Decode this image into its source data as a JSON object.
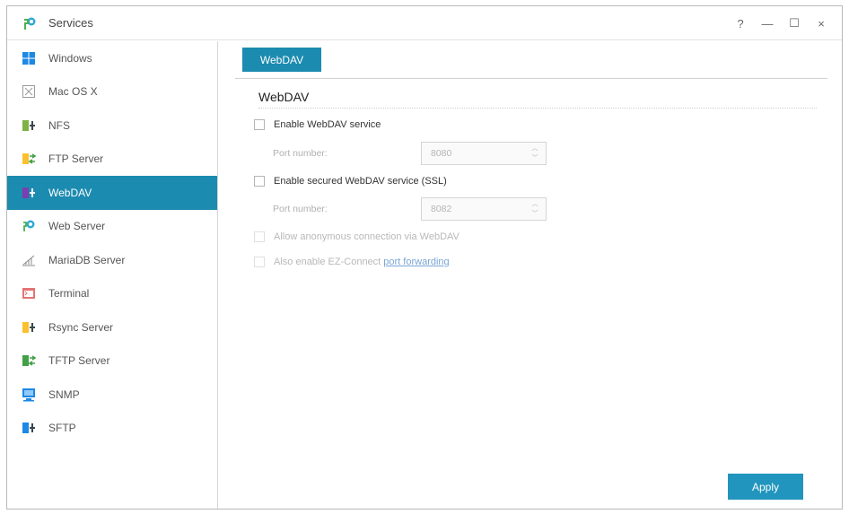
{
  "window": {
    "title": "Services",
    "controls": {
      "help": "?",
      "minimize": "—",
      "maximize": "☐",
      "close": "×"
    }
  },
  "sidebar": {
    "items": [
      {
        "label": "Windows",
        "icon": "windows-icon"
      },
      {
        "label": "Mac OS X",
        "icon": "macos-icon"
      },
      {
        "label": "NFS",
        "icon": "nfs-icon"
      },
      {
        "label": "FTP Server",
        "icon": "ftp-icon"
      },
      {
        "label": "WebDAV",
        "icon": "webdav-icon",
        "active": true
      },
      {
        "label": "Web Server",
        "icon": "web-server-icon"
      },
      {
        "label": "MariaDB Server",
        "icon": "mariadb-icon"
      },
      {
        "label": "Terminal",
        "icon": "terminal-icon"
      },
      {
        "label": "Rsync Server",
        "icon": "rsync-icon"
      },
      {
        "label": "TFTP Server",
        "icon": "tftp-icon"
      },
      {
        "label": "SNMP",
        "icon": "snmp-icon"
      },
      {
        "label": "SFTP",
        "icon": "sftp-icon"
      }
    ]
  },
  "main": {
    "tab": "WebDAV",
    "section_title": "WebDAV",
    "enable_webdav": "Enable WebDAV service",
    "port_label": "Port number:",
    "port_value": "8080",
    "enable_ssl": "Enable secured WebDAV service (SSL)",
    "ssl_port_label": "Port number:",
    "ssl_port_value": "8082",
    "anonymous": "Allow anonymous connection via WebDAV",
    "ezconnect_prefix": "Also enable EZ-Connect ",
    "ezconnect_link": "port forwarding",
    "apply": "Apply"
  },
  "colors": {
    "accent": "#1c8bb0",
    "apply": "#2195bd",
    "link": "#7aa6d6"
  }
}
